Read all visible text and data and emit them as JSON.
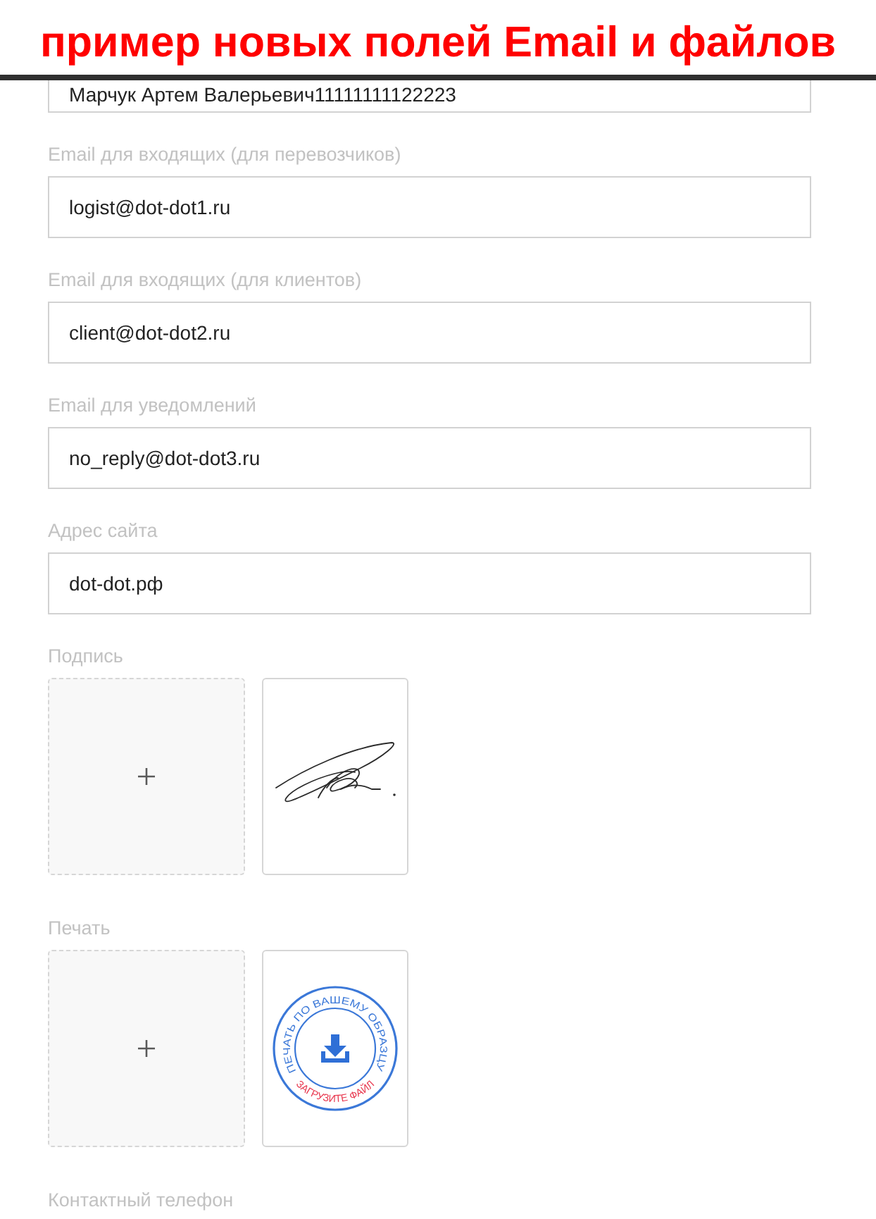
{
  "banner": {
    "title": "пример новых полей Email и файлов"
  },
  "form": [
    {
      "kind": "text",
      "value": "Марчук Артем Валерьевич11111111122223"
    },
    {
      "kind": "text",
      "label": "Email для входящих (для перевозчиков)",
      "value": "logist@dot-dot1.ru"
    },
    {
      "kind": "text",
      "label": "Email для входящих (для клиентов)",
      "value": "client@dot-dot2.ru"
    },
    {
      "kind": "text",
      "label": "Email для уведомлений",
      "value": "no_reply@dot-dot3.ru"
    },
    {
      "kind": "text",
      "label": "Адрес сайта",
      "value": "dot-dot.рф"
    },
    {
      "kind": "upload",
      "label": "Подпись",
      "files": [
        {
          "kind": "signature"
        }
      ]
    },
    {
      "kind": "upload",
      "label": "Печать",
      "files": [
        {
          "kind": "stamp",
          "ring_text": "ПЕЧАТЬ ПО ВАШЕМУ ОБРАЗЦУ",
          "note": "ЗАГРУЗИТЕ ФАЙЛ"
        }
      ]
    },
    {
      "kind": "text",
      "label": "Контактный телефон"
    }
  ]
}
